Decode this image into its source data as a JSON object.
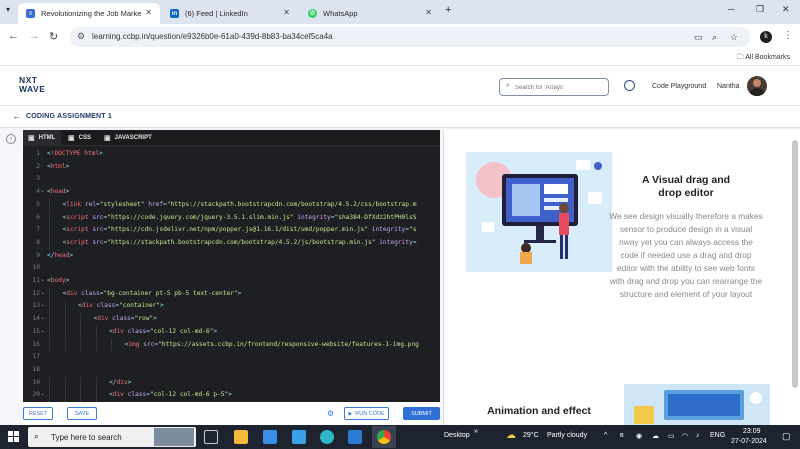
{
  "browser": {
    "tabs": [
      {
        "label": "Revolutionizing the Job Marke",
        "active": true
      },
      {
        "label": "(6) Feed | LinkedIn",
        "active": false
      },
      {
        "label": "WhatsApp",
        "active": false
      }
    ],
    "new_tab": "+",
    "url": "learning.ccbp.in/question/e9326b0e-61a0-439d-8b83-ba34cef5ca4a",
    "bookmarks_label": "All Bookmarks",
    "profile_initial": "k"
  },
  "app": {
    "logo_line1": "NXT",
    "logo_line2": "WAVE",
    "search_placeholder": "Search for 'Arrays'",
    "code_playground": "Code Playground",
    "user_name": "Nantha",
    "assignment_title": "CODING ASSIGNMENT 1"
  },
  "editor": {
    "tabs": [
      {
        "label": "HTML",
        "active": true
      },
      {
        "label": "CSS",
        "active": false
      },
      {
        "label": "JAVASCRIPT",
        "active": false
      }
    ],
    "lines": [
      {
        "n": "1",
        "fold": "",
        "indent": 0,
        "text": "<!DOCTYPE html>"
      },
      {
        "n": "2",
        "fold": "",
        "indent": 0,
        "text": "<html>"
      },
      {
        "n": "3",
        "fold": "",
        "indent": 0,
        "text": ""
      },
      {
        "n": "4",
        "fold": "▾",
        "indent": 0,
        "text": "<head>"
      },
      {
        "n": "5",
        "fold": "",
        "indent": 1,
        "text": "<link rel=\"stylesheet\" href=\"https://stackpath.bootstrapcdn.com/bootstrap/4.5.2/css/bootstrap.m"
      },
      {
        "n": "6",
        "fold": "",
        "indent": 1,
        "text": "<script src=\"https://code.jquery.com/jquery-3.5.1.slim.min.js\" integrity=\"sha384-DfXdz2htPH0lsS"
      },
      {
        "n": "7",
        "fold": "",
        "indent": 1,
        "text": "<script src=\"https://cdn.jsdelivr.net/npm/popper.js@1.16.1/dist/umd/popper.min.js\" integrity=\"s"
      },
      {
        "n": "8",
        "fold": "",
        "indent": 1,
        "text": "<script src=\"https://stackpath.bootstrapcdn.com/bootstrap/4.5.2/js/bootstrap.min.js\" integrity="
      },
      {
        "n": "9",
        "fold": "",
        "indent": 0,
        "text": "</head>"
      },
      {
        "n": "10",
        "fold": "",
        "indent": 0,
        "text": ""
      },
      {
        "n": "11",
        "fold": "▾",
        "indent": 0,
        "text": "<body>"
      },
      {
        "n": "12",
        "fold": "▾",
        "indent": 1,
        "text": "<div class=\"bg-container pt-5 pb-5 text-center\">"
      },
      {
        "n": "13",
        "fold": "▾",
        "indent": 2,
        "text": "<div class=\"container\">"
      },
      {
        "n": "14",
        "fold": "▾",
        "indent": 3,
        "text": "<div class=\"row\">"
      },
      {
        "n": "15",
        "fold": "▾",
        "indent": 4,
        "text": "<div class=\"col-12 col-md-6\">"
      },
      {
        "n": "16",
        "fold": "",
        "indent": 5,
        "text": "<img src=\"https://assets.ccbp.in/frontend/responsive-website/features-1-img.png"
      },
      {
        "n": "17",
        "fold": "",
        "indent": 0,
        "text": ""
      },
      {
        "n": "18",
        "fold": "",
        "indent": 0,
        "text": ""
      },
      {
        "n": "19",
        "fold": "",
        "indent": 4,
        "text": "</div>"
      },
      {
        "n": "20",
        "fold": "▾",
        "indent": 4,
        "text": "<div class=\"col-12 col-md-6 p-5\">"
      }
    ]
  },
  "actions": {
    "reset": "RESET",
    "save": "SAVE",
    "run_code": "RUN CODE",
    "submit": "SUBMIT"
  },
  "preview": {
    "heading": "A Visual drag and drop editor",
    "paragraph": "We see design visually therefore a makes sensor to produce design in a visual nway yet you can always access the code if needed use a drag and drop editor with the ability to see web fonts with drag and drop you can rearrange the structure and element of your layout",
    "heading2": "Animation and effect"
  },
  "taskbar": {
    "search_placeholder": "Type here to search",
    "desktop_label": "Desktop",
    "weather_temp": "29°C",
    "weather_desc": "Partly cloudy",
    "language": "ENG",
    "time": "23:09",
    "date": "27-07-2024"
  },
  "colors": {
    "accent": "#2f6fd8",
    "editor_bg": "#1e1f22",
    "brand_navy": "#12355b"
  }
}
